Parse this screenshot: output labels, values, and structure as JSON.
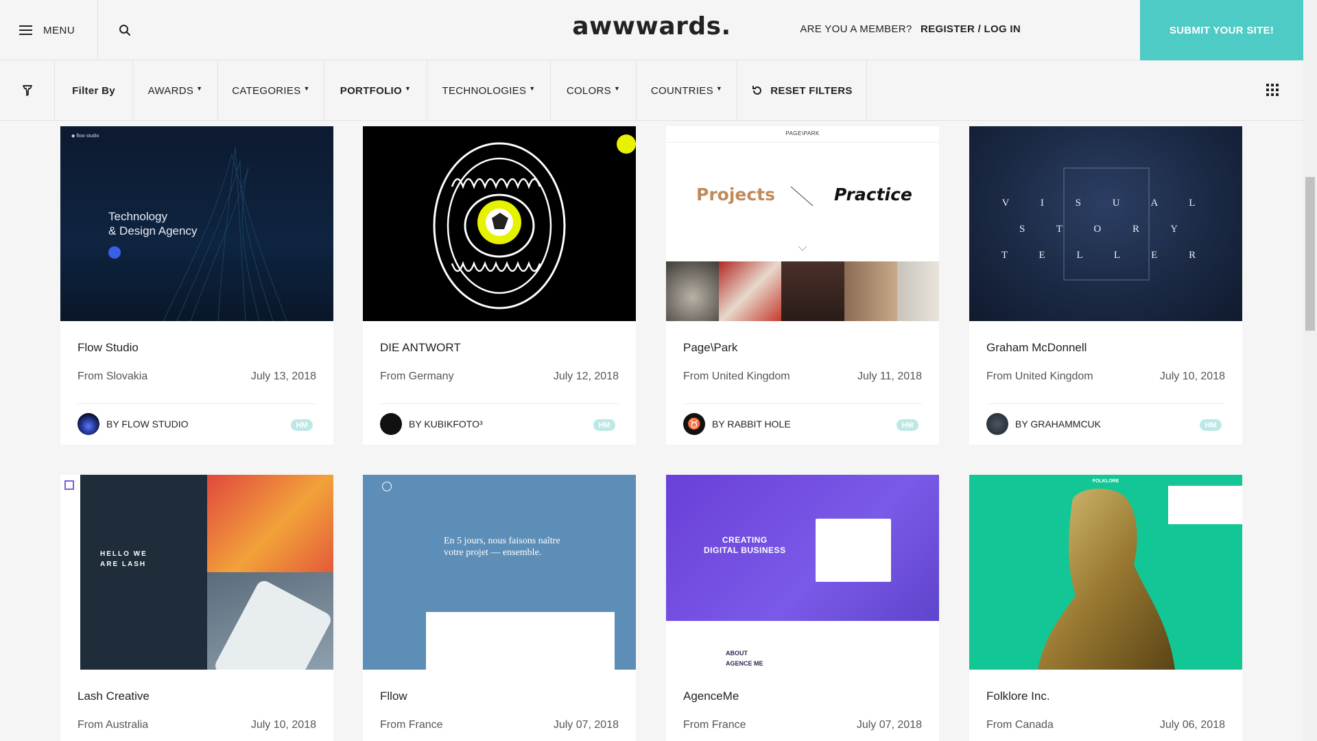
{
  "header": {
    "menu_label": "MENU",
    "logo": "awwwards.",
    "member_question": "ARE YOU A MEMBER?",
    "register_label": "REGISTER",
    "login_separator": " / ",
    "login_label": "LOG IN",
    "submit_label": "SUBMIT YOUR SITE!"
  },
  "filters": {
    "filter_by_label": "Filter By",
    "items": [
      "AWARDS",
      "CATEGORIES",
      "PORTFOLIO",
      "TECHNOLOGIES",
      "COLORS",
      "COUNTRIES"
    ],
    "reset_label": "RESET FILTERS"
  },
  "colors": {
    "accent": "#4ecbc4",
    "badge": "#bde8e6"
  },
  "cards": [
    {
      "title": "Flow Studio",
      "from": "From Slovakia",
      "date": "July 13, 2018",
      "by_prefix": "BY",
      "author": "FLOW STUDIO",
      "badge": "HM",
      "thumb_text": "Technology\n& Design Agency"
    },
    {
      "title": "DIE ANTWORT",
      "from": "From Germany",
      "date": "July 12, 2018",
      "by_prefix": "BY",
      "author": "KUBIKFOTO³",
      "badge": "HM"
    },
    {
      "title": "Page\\Park",
      "from": "From United Kingdom",
      "date": "July 11, 2018",
      "by_prefix": "BY",
      "author": "RABBIT HOLE",
      "badge": "HM",
      "thumb_left": "Projects",
      "thumb_right": "Practice",
      "thumb_brand": "PAGE\\PARK"
    },
    {
      "title": "Graham McDonnell",
      "from": "From United Kingdom",
      "date": "July 10, 2018",
      "by_prefix": "BY",
      "author": "GRAHAMMCUK",
      "badge": "HM",
      "thumb_lines": [
        "V I S U A L",
        "S T O R Y",
        "T E L L E R"
      ]
    },
    {
      "title": "Lash Creative",
      "from": "From Australia",
      "date": "July 10, 2018",
      "thumb_text": "HELLO WE\nARE LASH"
    },
    {
      "title": "Fllow",
      "from": "From France",
      "date": "July 07, 2018",
      "thumb_text": "En 5 jours, nous faisons naître\nvotre projet — ensemble."
    },
    {
      "title": "AgenceMe",
      "from": "From France",
      "date": "July 07, 2018",
      "thumb_text": "CREATING\nDIGITAL BUSINESS",
      "thumb_sub": "ABOUT\nAGENCE ME"
    },
    {
      "title": "Folklore Inc.",
      "from": "From Canada",
      "date": "July 06, 2018",
      "thumb_brand": "FOLKLORE"
    }
  ]
}
